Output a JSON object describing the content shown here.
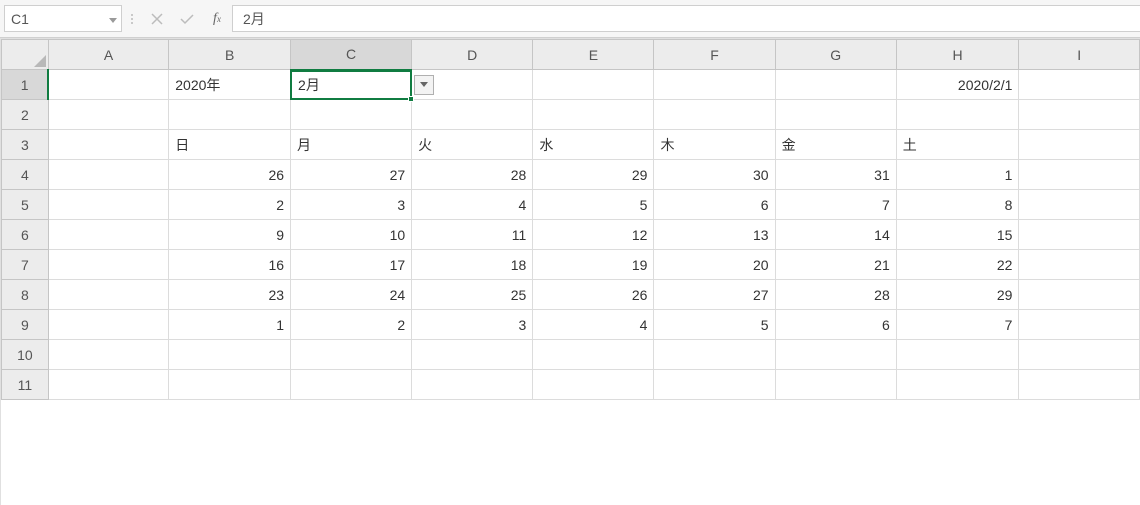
{
  "name_box": "C1",
  "formula_value": "2月",
  "columns": [
    "A",
    "B",
    "C",
    "D",
    "E",
    "F",
    "G",
    "H",
    "I"
  ],
  "rows": [
    "1",
    "2",
    "3",
    "4",
    "5",
    "6",
    "7",
    "8",
    "9",
    "10",
    "11"
  ],
  "active": {
    "col_index": 2,
    "row_index": 0
  },
  "cells": {
    "r1": {
      "B": "2020年",
      "C": "2月",
      "H": "2020/2/1"
    },
    "r3": {
      "B": "日",
      "C": "月",
      "D": "火",
      "E": "水",
      "F": "木",
      "G": "金",
      "H": "土"
    },
    "r4": {
      "B": "26",
      "C": "27",
      "D": "28",
      "E": "29",
      "F": "30",
      "G": "31",
      "H": "1"
    },
    "r5": {
      "B": "2",
      "C": "3",
      "D": "4",
      "E": "5",
      "F": "6",
      "G": "7",
      "H": "8"
    },
    "r6": {
      "B": "9",
      "C": "10",
      "D": "11",
      "E": "12",
      "F": "13",
      "G": "14",
      "H": "15"
    },
    "r7": {
      "B": "16",
      "C": "17",
      "D": "18",
      "E": "19",
      "F": "20",
      "G": "21",
      "H": "22"
    },
    "r8": {
      "B": "23",
      "C": "24",
      "D": "25",
      "E": "26",
      "F": "27",
      "G": "28",
      "H": "29"
    },
    "r9": {
      "B": "1",
      "C": "2",
      "D": "3",
      "E": "4",
      "F": "5",
      "G": "6",
      "H": "7"
    }
  },
  "align": {
    "r1": {
      "B": "l",
      "C": "l",
      "H": "r"
    },
    "r3": {
      "B": "l",
      "C": "l",
      "D": "l",
      "E": "l",
      "F": "l",
      "G": "l",
      "H": "l"
    },
    "default_numeric": "r"
  }
}
